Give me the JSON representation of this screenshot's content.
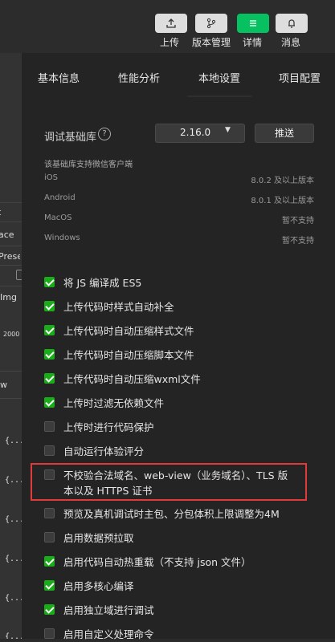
{
  "toolbar": {
    "buttons": [
      {
        "label": "上传",
        "icon": "upload-icon",
        "active": false
      },
      {
        "label": "版本管理",
        "icon": "version-branch-icon",
        "active": false
      },
      {
        "label": "详情",
        "icon": "details-menu-icon",
        "active": true
      },
      {
        "label": "消息",
        "icon": "bell-icon",
        "active": false
      }
    ]
  },
  "left_panel": {
    "fragments": [
      "t",
      "ace",
      "Prese",
      "Img",
      "2000",
      "w"
    ],
    "brace": "{..."
  },
  "tabs": [
    "基本信息",
    "性能分析",
    "本地设置",
    "项目配置"
  ],
  "active_tab": "本地设置",
  "library": {
    "label": "调试基础库",
    "help": "?",
    "version": "2.16.0",
    "push_label": "推送"
  },
  "support": {
    "title": "该基础库支持微信客户端",
    "rows": [
      {
        "os": "iOS",
        "status": "8.0.2 及以上版本"
      },
      {
        "os": "Android",
        "status": "8.0.1 及以上版本"
      },
      {
        "os": "MacOS",
        "status": "暂不支持"
      },
      {
        "os": "Windows",
        "status": "暂不支持"
      }
    ]
  },
  "options": [
    {
      "label": "将 JS 编译成 ES5",
      "checked": true
    },
    {
      "label": "上传代码时样式自动补全",
      "checked": true
    },
    {
      "label": "上传代码时自动压缩样式文件",
      "checked": true
    },
    {
      "label": "上传代码时自动压缩脚本文件",
      "checked": true
    },
    {
      "label": "上传代码时自动压缩wxml文件",
      "checked": true
    },
    {
      "label": "上传时过滤无依赖文件",
      "checked": true
    },
    {
      "label": "上传时进行代码保护",
      "checked": false
    },
    {
      "label": "自动运行体验评分",
      "checked": false
    },
    {
      "label": "不校验合法域名、web-view（业务域名）、TLS 版本以及 HTTPS 证书",
      "line1": "不校验合法域名、web-view（业务域名）、TLS 版",
      "line2": "本以及 HTTPS 证书",
      "checked": false,
      "highlighted": true
    },
    {
      "label": "预览及真机调试时主包、分包体积上限调整为4M",
      "checked": false
    },
    {
      "label": "启用数据预拉取",
      "checked": false
    },
    {
      "label": "启用代码自动热重载（不支持 json 文件）",
      "checked": true
    },
    {
      "label": "启用多核心编译",
      "checked": true
    },
    {
      "label": "启用独立域进行调试",
      "checked": true
    },
    {
      "label": "启用自定义处理命令",
      "checked": false
    }
  ],
  "colors": {
    "accent": "#07c160",
    "checkbox_on": "#1aad19",
    "highlight_border": "#e03a3a",
    "panel_bg": "#242424"
  }
}
